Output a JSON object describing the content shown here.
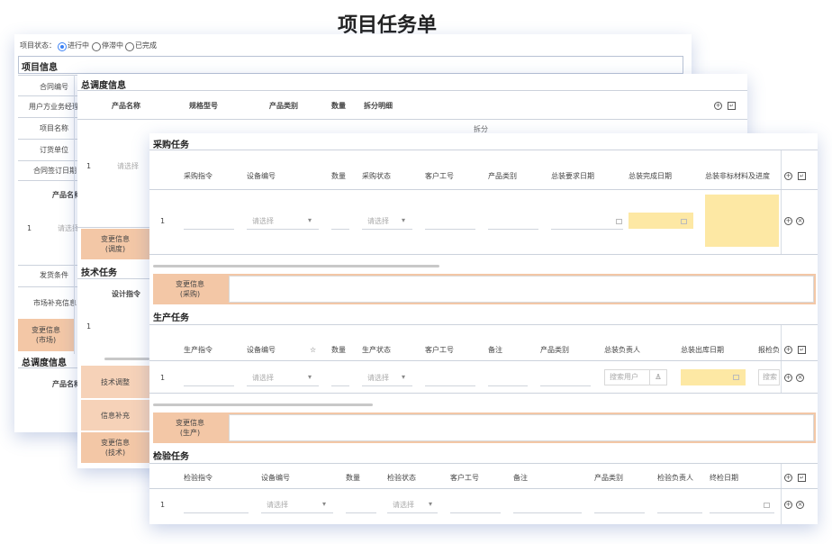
{
  "page_title": "项目任务单",
  "status": {
    "label": "项目状态：",
    "options": [
      "进行中",
      "停滞中",
      "已完成"
    ],
    "selected": "进行中"
  },
  "project_info": {
    "title": "项目信息",
    "fields": [
      "合同编号",
      "用户方业务经理",
      "项目名称",
      "订货单位",
      "合同签订日期"
    ],
    "product_header": "产品名称",
    "row_no": "1",
    "select_placeholder": "请选择",
    "fields2": [
      "发货条件",
      "市场补充信息"
    ],
    "change_info": [
      "变更信息",
      "(市场)"
    ],
    "scheduling_title": "总调度信息",
    "product_header2": "产品名称"
  },
  "scheduling": {
    "title": "总调度信息",
    "columns": [
      "产品名称",
      "规格型号",
      "产品类别",
      "数量",
      "拆分明细"
    ],
    "partial_text": "拆分",
    "row_no": "1",
    "select_placeholder": "请选择",
    "change_info": [
      "变更信息",
      "(调度)"
    ],
    "tech_title": "技术任务",
    "tech_col": "设计指令",
    "tech_row_no": "1",
    "tech_labels": [
      "技术调整",
      "信息补充"
    ],
    "tech_change": [
      "变更信息",
      "(技术)"
    ]
  },
  "purchase": {
    "title": "采购任务",
    "columns": [
      "采购指令",
      "设备编号",
      "数量",
      "采购状态",
      "客户工号",
      "产品类别",
      "总装要求日期",
      "总装完成日期",
      "总装非标材料及进度"
    ],
    "row_no": "1",
    "select1": "请选择",
    "select2": "请选择",
    "change_info": [
      "变更信息",
      "(采购)"
    ]
  },
  "production": {
    "title": "生产任务",
    "columns": [
      "生产指令",
      "设备编号",
      "数量",
      "生产状态",
      "客户工号",
      "备注",
      "产品类别",
      "总装负责人",
      "总装出库日期",
      "报检负"
    ],
    "row_no": "1",
    "select1": "请选择",
    "select2": "请选择",
    "search_user": "搜索用户",
    "search_short": "搜索",
    "change_info": [
      "变更信息",
      "(生产)"
    ]
  },
  "inspection": {
    "title": "检验任务",
    "columns": [
      "检验指令",
      "设备编号",
      "数量",
      "检验状态",
      "客户工号",
      "备注",
      "产品类别",
      "检验负责人",
      "终检日期"
    ],
    "row_no": "1",
    "select1": "请选择",
    "select2": "请选择"
  },
  "colors": {
    "accent_peach": "#f3c7a6",
    "highlight_yellow": "#fde8a4",
    "shadow_blue": "#506eb4"
  }
}
